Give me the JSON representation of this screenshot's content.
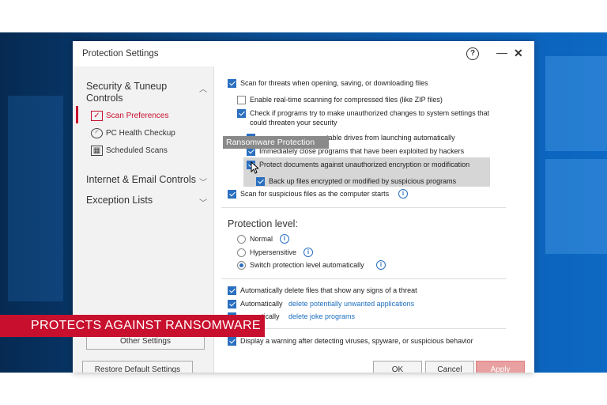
{
  "window": {
    "title": "Protection Settings",
    "help_icon": "help-circle-icon",
    "minimize_icon": "minimize-icon",
    "close_icon": "close-icon"
  },
  "sidebar": {
    "sections": [
      {
        "label": "Security & Tuneup Controls",
        "expanded": true
      },
      {
        "label": "Internet & Email Controls",
        "expanded": false
      },
      {
        "label": "Exception Lists",
        "expanded": false
      }
    ],
    "items": [
      {
        "label": "Scan Preferences",
        "icon": "scan-preferences-icon",
        "active": true
      },
      {
        "label": "PC Health Checkup",
        "icon": "gauge-icon",
        "active": false
      },
      {
        "label": "Scheduled Scans",
        "icon": "calendar-icon",
        "active": false
      }
    ],
    "other_settings": "Other Settings",
    "active_color": "#c8102e"
  },
  "main": {
    "scan_open": "Scan for threats when opening, saving, or downloading files",
    "realtime_compressed": "Enable real-time scanning for compressed files (like ZIP files)",
    "check_programs_1": "Check if programs try to make unauthorized changes to system settings that",
    "check_programs_2": "could threaten your security",
    "portable_drives": "portable drives from launching automatically",
    "close_exploited": "Immediately close programs that have been exploited by hackers",
    "protect_documents": "Protect documents against unauthorized encryption or modification",
    "backup_files": "Back up files encrypted or modified by suspicious programs",
    "scan_suspicious": "Scan for suspicious files as the computer starts",
    "protection_level_heading": "Protection level:",
    "levels": [
      "Normal",
      "Hypersensitive",
      "Switch protection level automatically"
    ],
    "selected_level": "Switch protection level automatically",
    "auto_delete": "Automatically delete files that show any signs of a threat",
    "auto_prefix": "Automatically",
    "auto_prefix_partial": "…tically",
    "delete_pua": "delete potentially unwanted applications",
    "delete_joke": "delete joke programs",
    "display_warning": "Display a warning after detecting viruses, spyware, or suspicious behavior"
  },
  "tooltip": "Ransomware Protection",
  "banner": "PROTECTS AGAINST RANSOMWARE",
  "buttons": {
    "restore": "Restore Default Settings",
    "ok": "OK",
    "cancel": "Cancel",
    "apply": "Apply"
  },
  "colors": {
    "accent": "#2a6fc0",
    "banner": "#c8102e",
    "apply_button": "#e8a0a0"
  }
}
